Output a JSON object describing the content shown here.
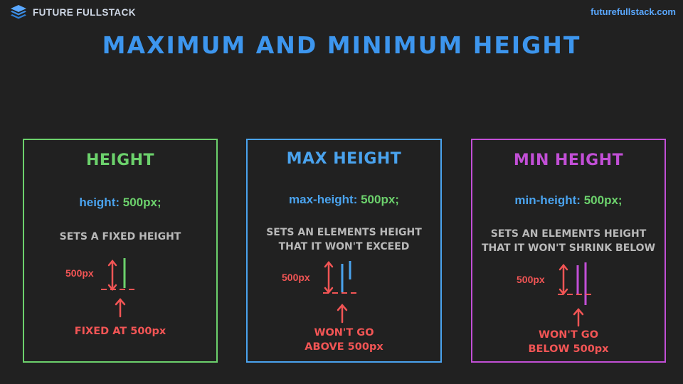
{
  "header": {
    "brand_name": "FUTURE FULLSTACK",
    "site_url": "futurefullstack.com",
    "logo_icon": "layers-stack-icon"
  },
  "title": "MAXIMUM AND MINIMUM HEIGHT",
  "colors": {
    "background": "#212121",
    "blue": "#4aa3ee",
    "green": "#6cd16c",
    "purple": "#c24fd6",
    "red": "#f25555",
    "grey": "#b9b9b9"
  },
  "cards": [
    {
      "title": "HEIGHT",
      "code_prop": "height:",
      "code_value": "500px;",
      "desc_line1": "SETS A FIXED HEIGHT",
      "desc_line2": "",
      "diagram_label": "500px",
      "result_line1": "FIXED AT 500px",
      "result_line2": ""
    },
    {
      "title": "MAX HEIGHT",
      "code_prop": "max-height:",
      "code_value": "500px;",
      "desc_line1": "SETS AN ELEMENTS HEIGHT",
      "desc_line2": "THAT IT WON'T EXCEED",
      "diagram_label": "500px",
      "result_line1": "WON'T GO",
      "result_line2": "ABOVE 500px"
    },
    {
      "title": "MIN HEIGHT",
      "code_prop": "min-height:",
      "code_value": "500px;",
      "desc_line1": "SETS AN ELEMENTS HEIGHT",
      "desc_line2": "THAT IT WON'T SHRINK BELOW",
      "diagram_label": "500px",
      "result_line1": "WON'T GO",
      "result_line2": "BELOW 500px"
    }
  ]
}
